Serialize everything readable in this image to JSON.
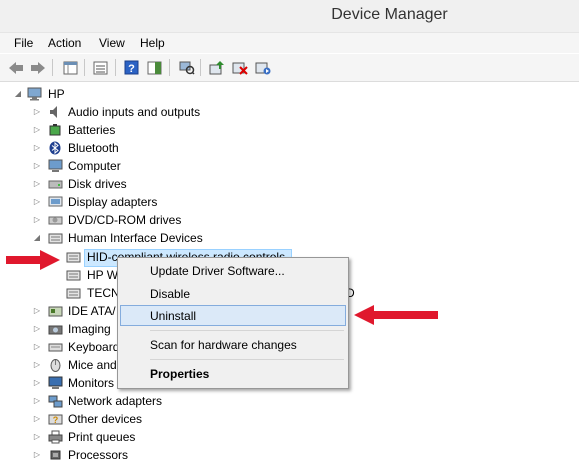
{
  "window": {
    "title": "Device Manager"
  },
  "menubar": {
    "items": [
      "File",
      "Action",
      "View",
      "Help"
    ]
  },
  "toolbar": {
    "icons": [
      "back-icon",
      "forward-icon",
      "properties-grid-icon",
      "console-tree-icon",
      "help-icon",
      "action-pane-icon",
      "scan-hardware-icon",
      "update-driver-icon",
      "uninstall-icon",
      "enable-device-icon"
    ]
  },
  "tree": {
    "root": "HP",
    "categories": [
      "Audio inputs and outputs",
      "Batteries",
      "Bluetooth",
      "Computer",
      "Disk drives",
      "Display adapters",
      "DVD/CD-ROM drives",
      "Human Interface Devices",
      "IDE ATA/",
      "Imaging",
      "Keyboard",
      "Mice and",
      "Monitors",
      "Network adapters",
      "Other devices",
      "Print queues",
      "Processors"
    ],
    "hid_children": [
      "HID-compliant wireless radio controls",
      "HP W",
      "TECN"
    ],
    "hid_child3_trailing": "D"
  },
  "context_menu": {
    "items": [
      "Update Driver Software...",
      "Disable",
      "Uninstall",
      "Scan for hardware changes",
      "Properties"
    ],
    "highlighted": "Uninstall"
  },
  "colors": {
    "arrow": "#e0182d",
    "selection": "#cce8ff",
    "menu_highlight": "#dbe9f8"
  }
}
